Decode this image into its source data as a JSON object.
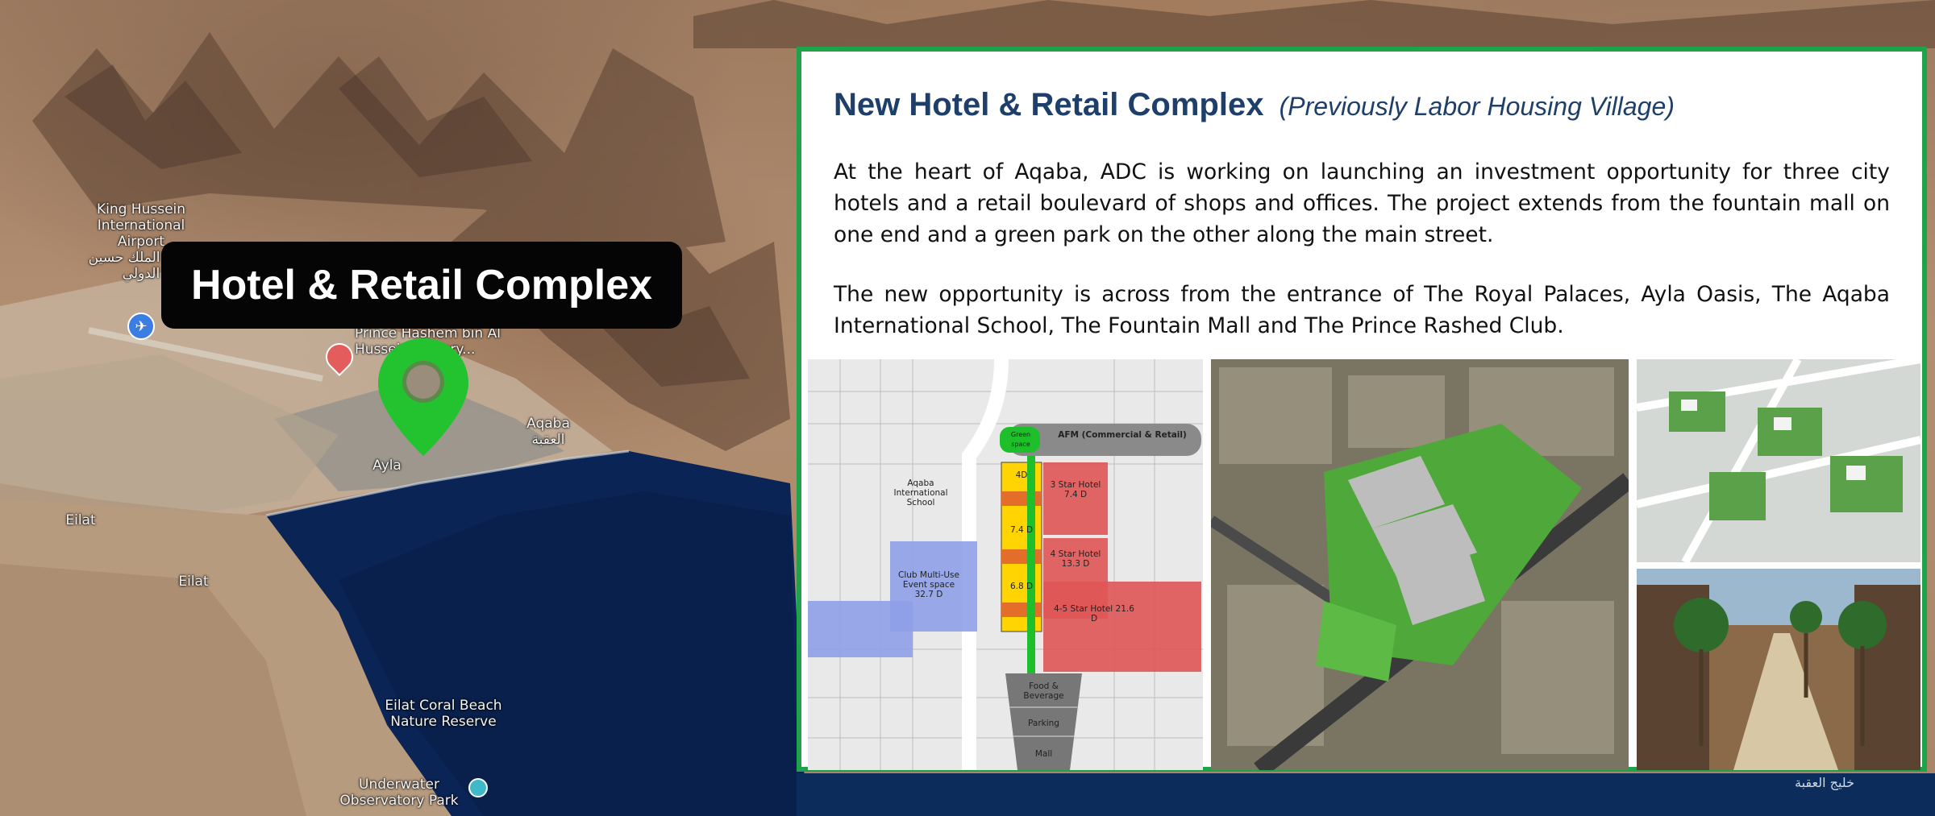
{
  "panel": {
    "title": "New Hotel & Retail Complex",
    "subtitle": "(Previously Labor Housing Village)",
    "paragraph_1": "At the heart of Aqaba, ADC is working on launching an investment opportunity for three city hotels and a retail boulevard of shops and offices. The project extends from the fountain mall on one end and a green park on the other along the main street.",
    "paragraph_2": "The new opportunity is across from the entrance of The Royal Palaces, Ayla Oasis, The Aqaba International School, The Fountain Mall and The Prince Rashed Club.",
    "site_plan_labels": {
      "afm": "AFM (Commercial & Retail)",
      "green_space": "Green space",
      "school": "Aqaba International School",
      "club": "Club Multi-Use Event space 32.7 D",
      "hotel_3star": "3 Star Hotel 7.4 D",
      "hotel_4star": "4 Star Hotel 13.3 D",
      "hotel_45star": "4-5 Star Hotel 21.6 D",
      "plot_4d": "4D",
      "plot_74d": "7.4 D",
      "plot_68d": "6.8 D",
      "food": "Food & Beverage",
      "parking": "Parking",
      "mall": "Mall"
    }
  },
  "callout": {
    "label": "Hotel & Retail Complex"
  },
  "map_labels": {
    "airport": "King Hussein International Airport",
    "airport_arabic": "مطار الملك حسين الدولي",
    "hospital": "Prince Hashem bin Al Hussein Military...",
    "aqaba": "Aqaba",
    "aqaba_arabic": "العقبة",
    "ayla": "Ayla",
    "eilat_1": "Eilat",
    "eilat_2": "Eilat",
    "coral_beach": "Eilat Coral Beach Nature Reserve",
    "observatory": "Underwater Observatory Park"
  },
  "watermark": "خليج العقبة",
  "colors": {
    "panel_border": "#1fa34a",
    "title": "#1f3f6b",
    "pin": "#22c32e",
    "callout_bg": "#050505"
  },
  "icons": {
    "pin": "location-pin-icon",
    "airport": "airport-icon",
    "hospital": "hospital-icon",
    "observatory": "landmark-icon"
  }
}
